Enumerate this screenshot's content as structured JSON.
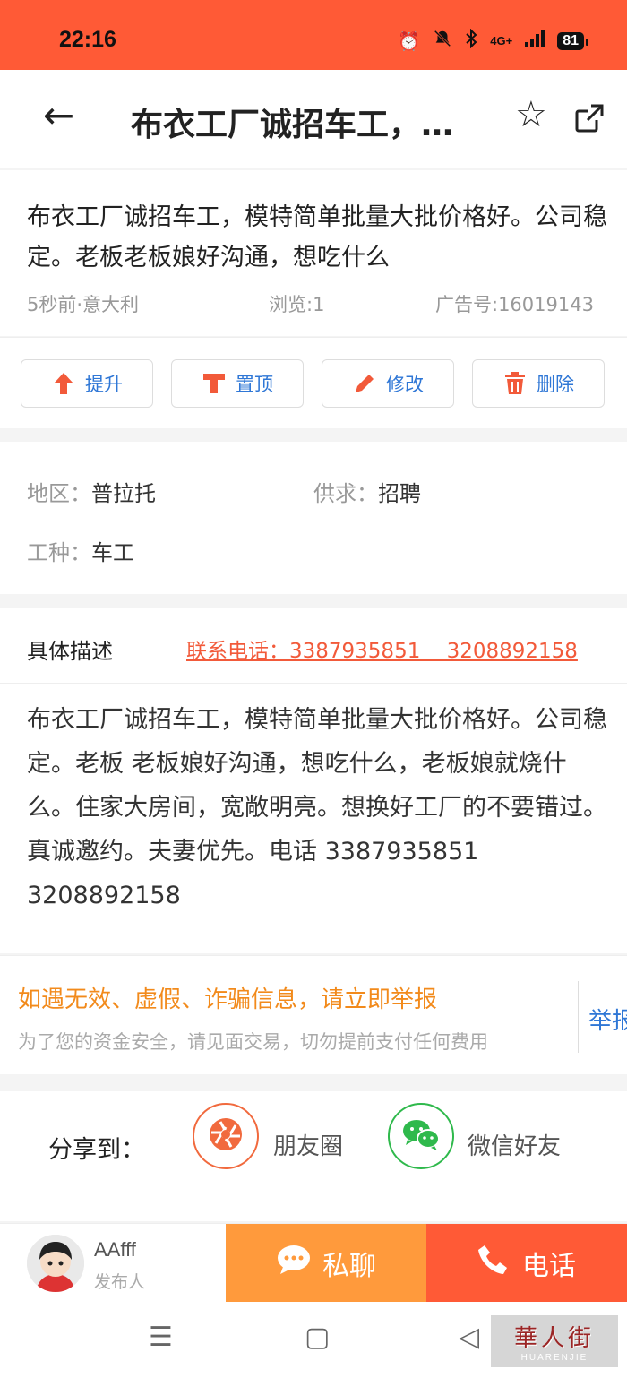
{
  "status_bar": {
    "time": "22:16",
    "network": "4G+",
    "battery": "81"
  },
  "nav": {
    "title": "布衣工厂诚招车工，…"
  },
  "post": {
    "title": "布衣工厂诚招车工，模特简单批量大批价格好。公司稳定。老板老板娘好沟通，想吃什么",
    "time_location": "5秒前·意大利",
    "views": "浏览:1",
    "ad_number": "广告号:16019143"
  },
  "actions": [
    {
      "label": "提升"
    },
    {
      "label": "置顶"
    },
    {
      "label": "修改"
    },
    {
      "label": "删除"
    }
  ],
  "fields": {
    "region_key": "地区：",
    "region_val": "普拉托",
    "supply_key": "供求：",
    "supply_val": "招聘",
    "job_key": "工种：",
    "job_val": "车工"
  },
  "description": {
    "label": "具体描述",
    "phone_line": "联系电话：3387935851    3208892158",
    "body": "布衣工厂诚招车工，模特简单批量大批价格好。公司稳定。老板 老板娘好沟通，想吃什么，老板娘就烧什么。住家大房间，宽敞明亮。想换好工厂的不要错过。真诚邀约。夫妻优先。电话 3387935851  3208892158"
  },
  "warning": {
    "title": "如遇无效、虚假、诈骗信息，请立即举报",
    "subtitle": "为了您的资金安全，请见面交易，切勿提前支付任何费用",
    "report": "举报"
  },
  "share": {
    "label": "分享到：",
    "moments": "朋友圈",
    "wechat": "微信好友"
  },
  "publisher": {
    "name": "AAfff",
    "role": "发布人"
  },
  "bottom_actions": {
    "chat": "私聊",
    "call": "电话"
  },
  "watermark": {
    "cn": "華人街",
    "en": "HUARENJIE"
  },
  "colors": {
    "accent": "#ff5a36",
    "chat": "#ff9a3c",
    "link": "#2f77d6",
    "warning": "#f28a1b"
  }
}
